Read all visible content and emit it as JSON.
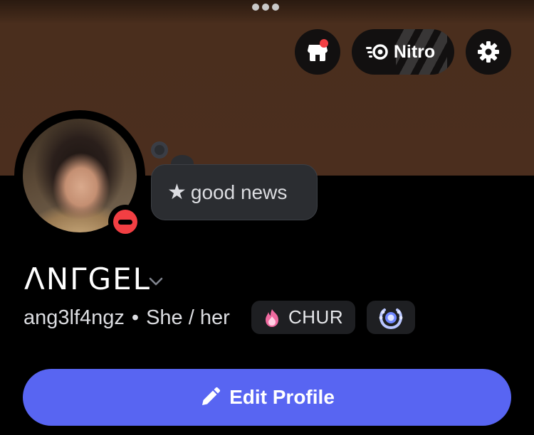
{
  "colors": {
    "banner": "#4b2e1e",
    "background": "#000000",
    "accent": "#5865f2",
    "status_dnd": "#f23f43",
    "notification_dot": "#f23f43",
    "pill_bg": "#1e1f22",
    "bubble_bg": "#2b2d31"
  },
  "header": {
    "menu_icon": "more-dots-icon",
    "shop_icon": "shop-icon",
    "nitro": {
      "icon": "nitro-icon",
      "label": "Nitro"
    },
    "settings_icon": "gear-icon"
  },
  "profile": {
    "status": "do-not-disturb",
    "custom_status": {
      "icon": "star-icon",
      "glyph": "★",
      "text": "good news"
    },
    "display_name": "ᐱΝΓGΕL",
    "username": "ang3lf4ngz",
    "separator": "•",
    "pronouns": "She / her",
    "guild_tag": {
      "icon": "pink-flame-icon",
      "text": "CHUR"
    },
    "badge_icon": "laurel-badge-icon"
  },
  "actions": {
    "edit_profile_label": "Edit Profile",
    "edit_icon": "pencil-icon"
  }
}
